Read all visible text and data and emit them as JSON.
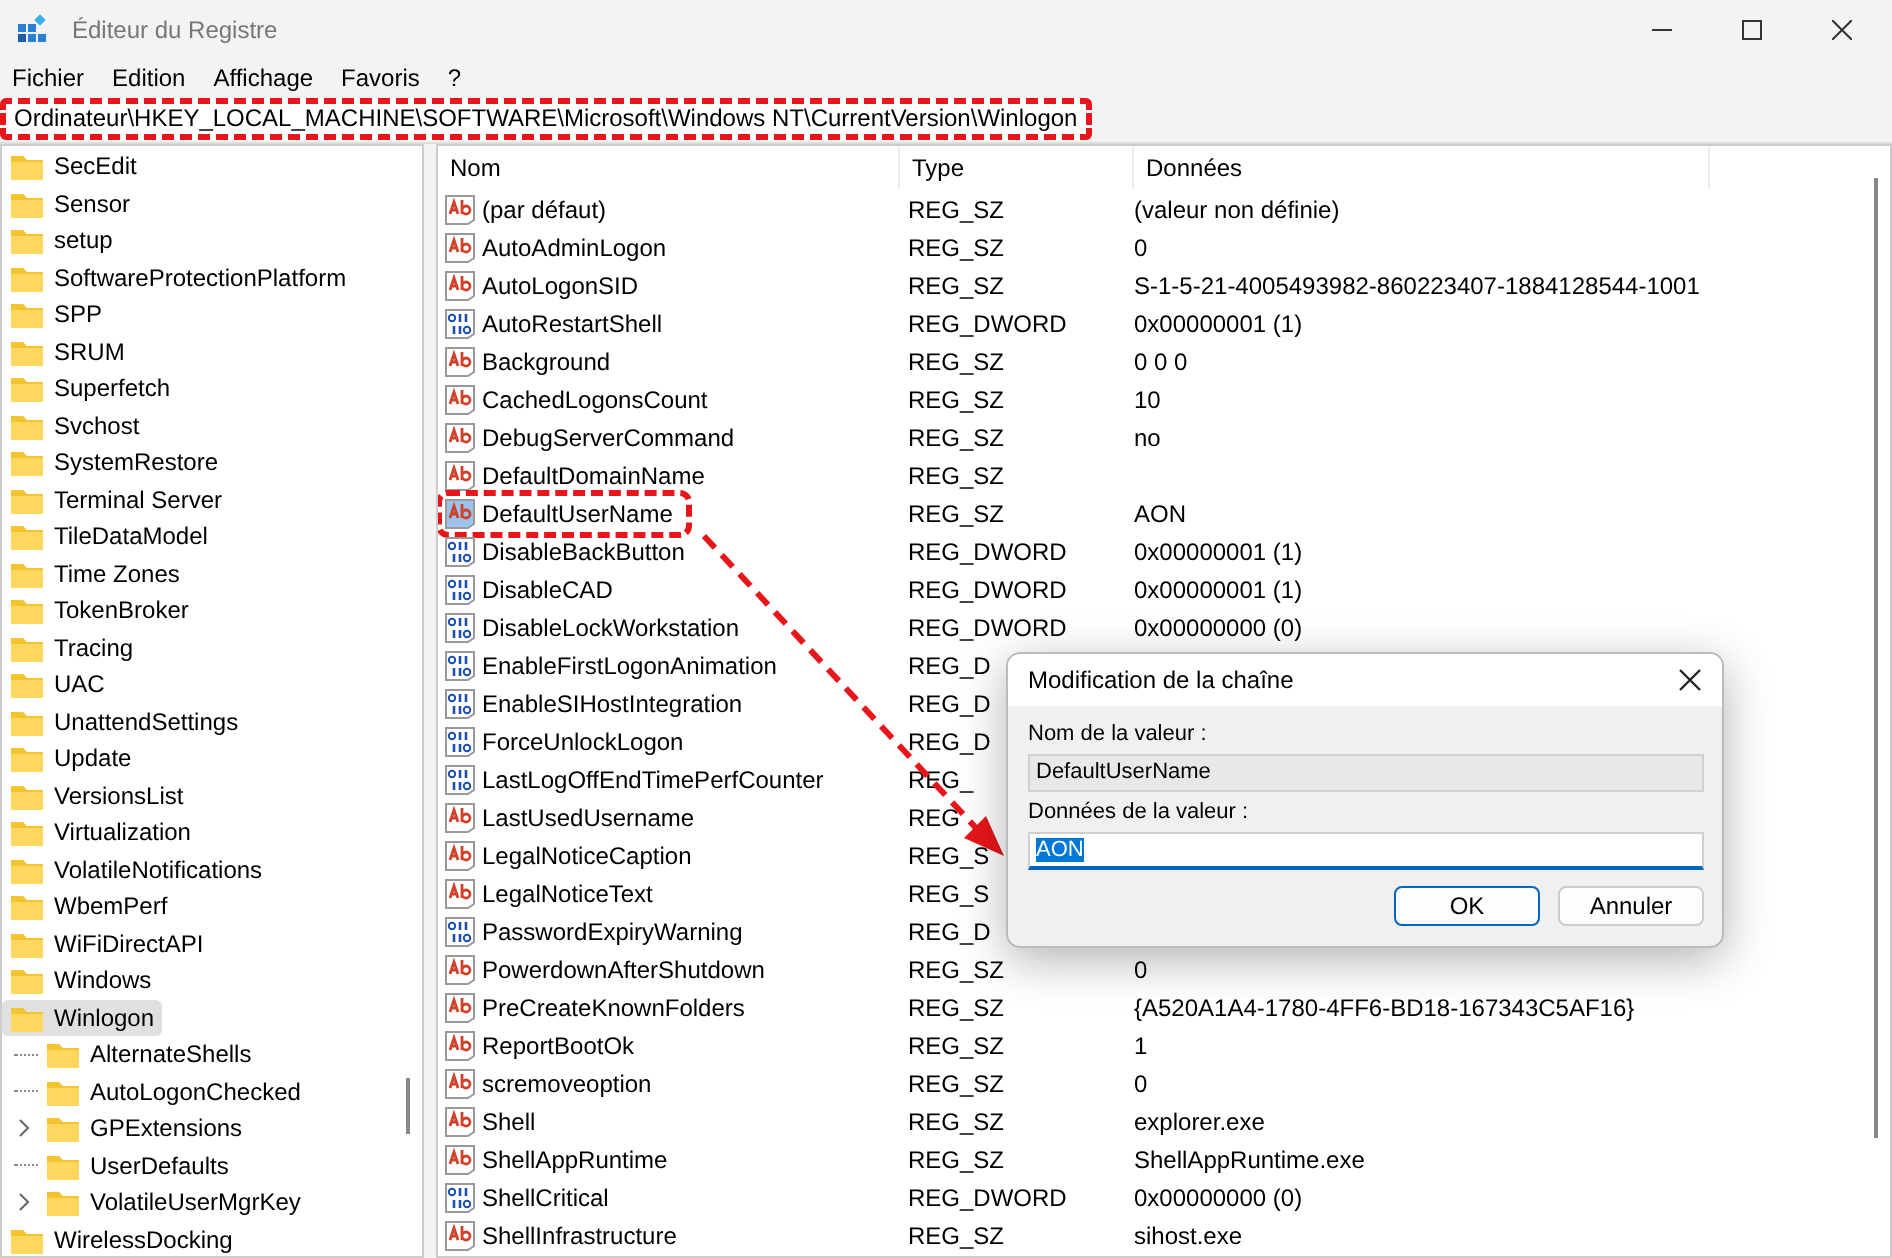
{
  "window": {
    "title": "Éditeur du Registre"
  },
  "menu": [
    "Fichier",
    "Edition",
    "Affichage",
    "Favoris",
    "?"
  ],
  "address": {
    "value": "Ordinateur\\HKEY_LOCAL_MACHINE\\SOFTWARE\\Microsoft\\Windows NT\\CurrentVersion\\Winlogon",
    "annotated": true
  },
  "tree": [
    {
      "label": "SecEdit",
      "selected": false
    },
    {
      "label": "Sensor",
      "selected": false
    },
    {
      "label": "setup",
      "selected": false
    },
    {
      "label": "SoftwareProtectionPlatform",
      "selected": false
    },
    {
      "label": "SPP",
      "selected": false
    },
    {
      "label": "SRUM",
      "selected": false
    },
    {
      "label": "Superfetch",
      "selected": false
    },
    {
      "label": "Svchost",
      "selected": false
    },
    {
      "label": "SystemRestore",
      "selected": false
    },
    {
      "label": "Terminal Server",
      "selected": false
    },
    {
      "label": "TileDataModel",
      "selected": false
    },
    {
      "label": "Time Zones",
      "selected": false
    },
    {
      "label": "TokenBroker",
      "selected": false
    },
    {
      "label": "Tracing",
      "selected": false
    },
    {
      "label": "UAC",
      "selected": false
    },
    {
      "label": "UnattendSettings",
      "selected": false
    },
    {
      "label": "Update",
      "selected": false
    },
    {
      "label": "VersionsList",
      "selected": false
    },
    {
      "label": "Virtualization",
      "selected": false
    },
    {
      "label": "VolatileNotifications",
      "selected": false
    },
    {
      "label": "WbemPerf",
      "selected": false
    },
    {
      "label": "WiFiDirectAPI",
      "selected": false
    },
    {
      "label": "Windows",
      "selected": false
    },
    {
      "label": "Winlogon",
      "selected": true,
      "children": [
        {
          "label": "AlternateShells",
          "selected": false,
          "expandable": false
        },
        {
          "label": "AutoLogonChecked",
          "selected": false,
          "expandable": false
        },
        {
          "label": "GPExtensions",
          "selected": false,
          "expandable": true
        },
        {
          "label": "UserDefaults",
          "selected": false,
          "expandable": false
        },
        {
          "label": "VolatileUserMgrKey",
          "selected": false,
          "expandable": true
        }
      ]
    },
    {
      "label": "WirelessDocking",
      "selected": false
    }
  ],
  "table": {
    "columns": [
      "Nom",
      "Type",
      "Données"
    ],
    "rows": [
      {
        "kind": "text",
        "name": "(par défaut)",
        "type": "REG_SZ",
        "data": "(valeur non définie)",
        "selected": false,
        "annotated": false
      },
      {
        "kind": "text",
        "name": "AutoAdminLogon",
        "type": "REG_SZ",
        "data": "0",
        "selected": false,
        "annotated": false
      },
      {
        "kind": "text",
        "name": "AutoLogonSID",
        "type": "REG_SZ",
        "data": "S-1-5-21-4005493982-860223407-1884128544-1001",
        "selected": false,
        "annotated": false
      },
      {
        "kind": "binary",
        "name": "AutoRestartShell",
        "type": "REG_DWORD",
        "data": "0x00000001 (1)",
        "selected": false,
        "annotated": false
      },
      {
        "kind": "text",
        "name": "Background",
        "type": "REG_SZ",
        "data": "0 0 0",
        "selected": false,
        "annotated": false
      },
      {
        "kind": "text",
        "name": "CachedLogonsCount",
        "type": "REG_SZ",
        "data": "10",
        "selected": false,
        "annotated": false
      },
      {
        "kind": "text",
        "name": "DebugServerCommand",
        "type": "REG_SZ",
        "data": "no",
        "selected": false,
        "annotated": false
      },
      {
        "kind": "text",
        "name": "DefaultDomainName",
        "type": "REG_SZ",
        "selected": false,
        "annotated": false
      },
      {
        "kind": "text",
        "name": "DefaultUserName",
        "type": "REG_SZ",
        "data": "AON",
        "selected": true,
        "annotated": true
      },
      {
        "kind": "binary",
        "name": "DisableBackButton",
        "type": "REG_DWORD",
        "data": "0x00000001 (1)",
        "selected": false,
        "annotated": false
      },
      {
        "kind": "binary",
        "name": "DisableCAD",
        "type": "REG_DWORD",
        "data": "0x00000001 (1)",
        "selected": false,
        "annotated": false
      },
      {
        "kind": "binary",
        "name": "DisableLockWorkstation",
        "type": "REG_DWORD",
        "data": "0x00000000 (0)",
        "selected": false,
        "annotated": false
      },
      {
        "kind": "binary",
        "name": "EnableFirstLogonAnimation",
        "type": "REG_D",
        "selected": false,
        "annotated": false
      },
      {
        "kind": "binary",
        "name": "EnableSIHostIntegration",
        "type": "REG_D",
        "selected": false,
        "annotated": false
      },
      {
        "kind": "binary",
        "name": "ForceUnlockLogon",
        "type": "REG_D",
        "selected": false,
        "annotated": false
      },
      {
        "kind": "binary",
        "name": "LastLogOffEndTimePerfCounter",
        "type": "REG_",
        "selected": false,
        "annotated": false
      },
      {
        "kind": "text",
        "name": "LastUsedUsername",
        "type": "REG",
        "selected": false,
        "annotated": false
      },
      {
        "kind": "text",
        "name": "LegalNoticeCaption",
        "type": "REG_S",
        "selected": false,
        "annotated": false
      },
      {
        "kind": "text",
        "name": "LegalNoticeText",
        "type": "REG_S",
        "selected": false,
        "annotated": false
      },
      {
        "kind": "binary",
        "name": "PasswordExpiryWarning",
        "type": "REG_D",
        "selected": false,
        "annotated": false
      },
      {
        "kind": "text",
        "name": "PowerdownAfterShutdown",
        "type": "REG_SZ",
        "data": "0",
        "selected": false,
        "annotated": false
      },
      {
        "kind": "text",
        "name": "PreCreateKnownFolders",
        "type": "REG_SZ",
        "data": "{A520A1A4-1780-4FF6-BD18-167343C5AF16}",
        "selected": false,
        "annotated": false
      },
      {
        "kind": "text",
        "name": "ReportBootOk",
        "type": "REG_SZ",
        "data": "1",
        "selected": false,
        "annotated": false
      },
      {
        "kind": "text",
        "name": "scremoveoption",
        "type": "REG_SZ",
        "data": "0",
        "selected": false,
        "annotated": false
      },
      {
        "kind": "text",
        "name": "Shell",
        "type": "REG_SZ",
        "data": "explorer.exe",
        "selected": false,
        "annotated": false
      },
      {
        "kind": "text",
        "name": "ShellAppRuntime",
        "type": "REG_SZ",
        "data": "ShellAppRuntime.exe",
        "selected": false,
        "annotated": false
      },
      {
        "kind": "binary",
        "name": "ShellCritical",
        "type": "REG_DWORD",
        "data": "0x00000000 (0)",
        "selected": false,
        "annotated": false
      },
      {
        "kind": "text",
        "name": "ShellInfrastructure",
        "type": "REG_SZ",
        "data": "sihost.exe",
        "selected": false,
        "annotated": false
      }
    ]
  },
  "dialog": {
    "title": "Modification de la chaîne",
    "name_label": "Nom de la valeur :",
    "name_value": "DefaultUserName",
    "data_label": "Données de la valeur :",
    "data_value": "AON",
    "data_text_selected": true,
    "buttons": [
      {
        "label": "OK",
        "default": true
      },
      {
        "label": "Annuler",
        "default": false
      }
    ]
  }
}
